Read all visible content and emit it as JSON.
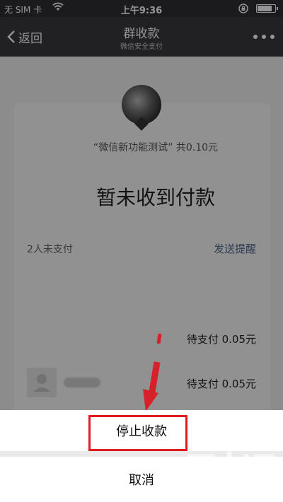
{
  "status_bar": {
    "carrier": "无 SIM 卡",
    "time": "上午9:36",
    "wifi_icon": "wifi-icon",
    "lock_icon": "rotation-lock-icon",
    "battery_level": 0.85
  },
  "nav": {
    "back_label": "返回",
    "title": "群收款",
    "subtitle": "微信安全支付",
    "more_icon": "more-dots-icon"
  },
  "card": {
    "group_line": "“微信新功能测试” 共0.10元",
    "status": "暂未收到付款",
    "unpaid_count": "2人未支付",
    "send_reminder": "发送提醒",
    "payments": [
      {
        "label": "待支付 0.05元"
      },
      {
        "label": "待支付 0.05元"
      }
    ]
  },
  "action_sheet": {
    "stop_label": "停止收款",
    "cancel_label": "取消"
  },
  "colors": {
    "highlight": "#e21a22",
    "link": "#576b95",
    "navbar": "#393a3f"
  }
}
